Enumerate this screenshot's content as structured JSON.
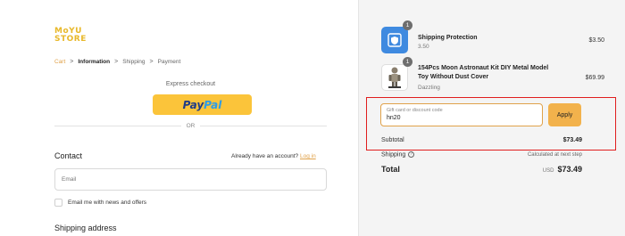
{
  "brand": {
    "logo_line1": "MoYU",
    "logo_line2": "STORE"
  },
  "breadcrumb": {
    "items": [
      "Cart",
      "Information",
      "Shipping",
      "Payment"
    ],
    "separator": ">"
  },
  "express": {
    "label": "Express checkout",
    "paypal_pay": "Pay",
    "paypal_pal": "Pal",
    "or_label": "OR"
  },
  "contact": {
    "title": "Contact",
    "account_prompt": "Already have an account?",
    "login_link": "Log in",
    "email_placeholder": "Email",
    "newsletter_label": "Email me with news and offers"
  },
  "shipping": {
    "title": "Shipping address"
  },
  "order": {
    "items": [
      {
        "name": "Shipping Protection",
        "subtitle": "3.50",
        "price": "$3.50",
        "quantity": "1",
        "icon": "shield-icon"
      },
      {
        "name": "154Pcs Moon Astronaut Kit DIY Metal Model Toy Without Dust Cover",
        "subtitle": "Dazzling",
        "price": "$69.99",
        "quantity": "1",
        "icon": "astronaut-model-image"
      }
    ],
    "discount": {
      "placeholder": "Gift card or discount code",
      "value": "hn20",
      "apply_label": "Apply"
    },
    "subtotal_label": "Subtotal",
    "subtotal_value": "$73.49",
    "shipping_label": "Shipping",
    "shipping_value": "Calculated at next step",
    "total_label": "Total",
    "currency": "USD",
    "total_value": "$73.49"
  },
  "colors": {
    "accent": "#e0a24a",
    "apply_button": "#f2b24c",
    "paypal_button": "#fbc43a",
    "highlight": "#e01e1e"
  }
}
